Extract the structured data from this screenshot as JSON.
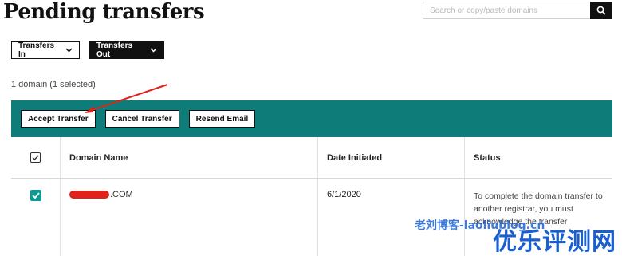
{
  "page": {
    "title": "Pending transfers"
  },
  "search": {
    "placeholder": "Search or copy/paste domains",
    "button_icon": "search-icon"
  },
  "filters": {
    "transfers_in": "Transfers In",
    "transfers_out": "Transfers Out"
  },
  "selection": {
    "count_text": "1 domain (1 selected)"
  },
  "actions": {
    "accept": "Accept Transfer",
    "cancel": "Cancel Transfer",
    "resend": "Resend Email"
  },
  "table": {
    "columns": [
      "Domain Name",
      "Date Initiated",
      "Status"
    ],
    "rows": [
      {
        "selected": true,
        "domain_suffix": ".COM",
        "date": "6/1/2020",
        "status": "To complete the domain transfer to another registrar, you must acknowledge the transfer"
      }
    ]
  },
  "watermark": {
    "line1": "老刘博客-laoliublog.cn",
    "line2": "优乐评测网"
  },
  "colors": {
    "accent": "#0e7c78",
    "checkbox": "#0e9a93",
    "annotation": "#e0211c",
    "watermark": "#1a5fd0"
  }
}
